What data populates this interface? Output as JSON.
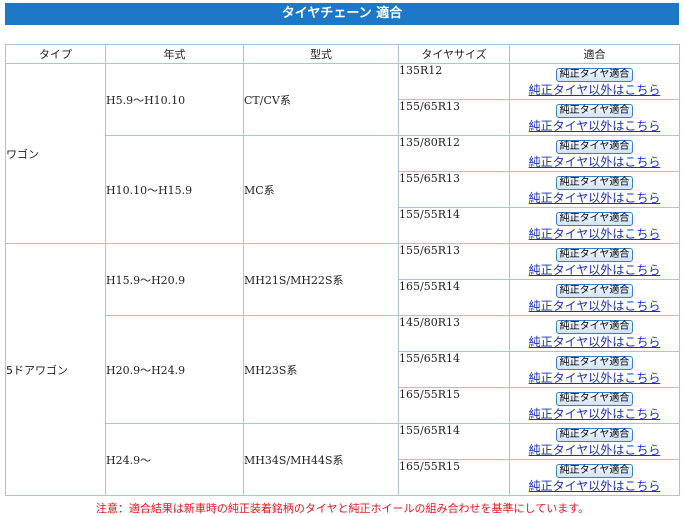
{
  "title": "タイヤチェーン 適合",
  "headers": [
    "タイプ",
    "年式",
    "型式",
    "タイヤサイズ",
    "適合"
  ],
  "row_button_label": "純正タイヤ適合",
  "row_link_label": "純正タイヤ以外はこちら",
  "types": [
    {
      "type": "ワゴン",
      "years": [
        {
          "year": "H5.9〜H10.10",
          "model": "CT/CV系",
          "sizes": [
            "135R12",
            "155/65R13"
          ]
        },
        {
          "year": "H10.10〜H15.9",
          "model": "MC系",
          "sizes": [
            "135/80R12",
            "155/65R13",
            "155/55R14"
          ]
        }
      ]
    },
    {
      "type": "5ドアワゴン",
      "years": [
        {
          "year": "H15.9〜H20.9",
          "model": "MH21S/MH22S系",
          "sizes": [
            "155/65R13",
            "165/55R14"
          ]
        },
        {
          "year": "H20.9〜H24.9",
          "model": "MH23S系",
          "sizes": [
            "145/80R13",
            "155/65R14",
            "165/55R15"
          ]
        },
        {
          "year": "H24.9〜",
          "model": "MH34S/MH44S系",
          "sizes": [
            "155/65R14",
            "165/55R15"
          ]
        }
      ]
    }
  ],
  "note": "注意：適合結果は新車時の純正装着銘柄のタイヤと純正ホイールの組み合わせを基準にしています。"
}
